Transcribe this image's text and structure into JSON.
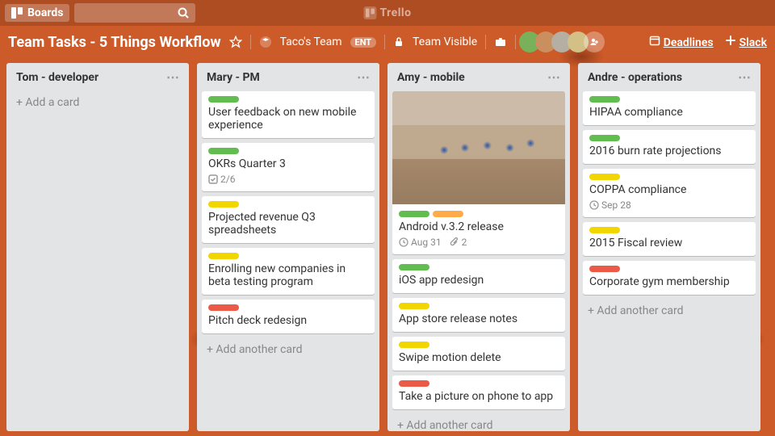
{
  "brand": "Trello",
  "topbar": {
    "boards_label": "Boards"
  },
  "board": {
    "title": "Team Tasks - 5 Things Workflow",
    "team_name": "Taco's Team",
    "team_badge": "ENT",
    "visibility": "Team Visible",
    "right_links": {
      "deadlines": "Deadlines",
      "slack": "Slack"
    }
  },
  "colors": {
    "green": "#61bd4f",
    "yellow": "#f2d600",
    "orange": "#ffab4a",
    "red": "#eb5a46"
  },
  "lists": [
    {
      "title": "Tom - developer",
      "add_label": "Add a card",
      "cards": []
    },
    {
      "title": "Mary - PM",
      "add_label": "Add another card",
      "cards": [
        {
          "labels": [
            "green"
          ],
          "text": "User feedback on new mobile experience"
        },
        {
          "labels": [
            "green"
          ],
          "text": "OKRs Quarter 3",
          "checklist": "2/6"
        },
        {
          "labels": [
            "yellow"
          ],
          "text": "Projected revenue Q3 spreadsheets"
        },
        {
          "labels": [
            "yellow"
          ],
          "text": "Enrolling new companies in beta testing program"
        },
        {
          "labels": [
            "red"
          ],
          "text": "Pitch deck redesign"
        }
      ]
    },
    {
      "title": "Amy - mobile",
      "add_label": "Add another card",
      "cards": [
        {
          "labels": [
            "green",
            "orange"
          ],
          "text": "Android v.3.2 release",
          "cover": true,
          "due": "Aug 31",
          "attachments": "2"
        },
        {
          "labels": [
            "green"
          ],
          "text": "iOS app redesign"
        },
        {
          "labels": [
            "yellow"
          ],
          "text": "App store release notes"
        },
        {
          "labels": [
            "yellow"
          ],
          "text": "Swipe motion delete"
        },
        {
          "labels": [
            "red"
          ],
          "text": "Take a picture on phone to app"
        }
      ]
    },
    {
      "title": "Andre - operations",
      "add_label": "Add another card",
      "cards": [
        {
          "labels": [
            "green"
          ],
          "text": "HIPAA compliance"
        },
        {
          "labels": [
            "green"
          ],
          "text": "2016 burn rate projections"
        },
        {
          "labels": [
            "yellow"
          ],
          "text": "COPPA compliance",
          "due": "Sep 28"
        },
        {
          "labels": [
            "yellow"
          ],
          "text": "2015 Fiscal review"
        },
        {
          "labels": [
            "red"
          ],
          "text": "Corporate gym membership"
        }
      ]
    }
  ]
}
